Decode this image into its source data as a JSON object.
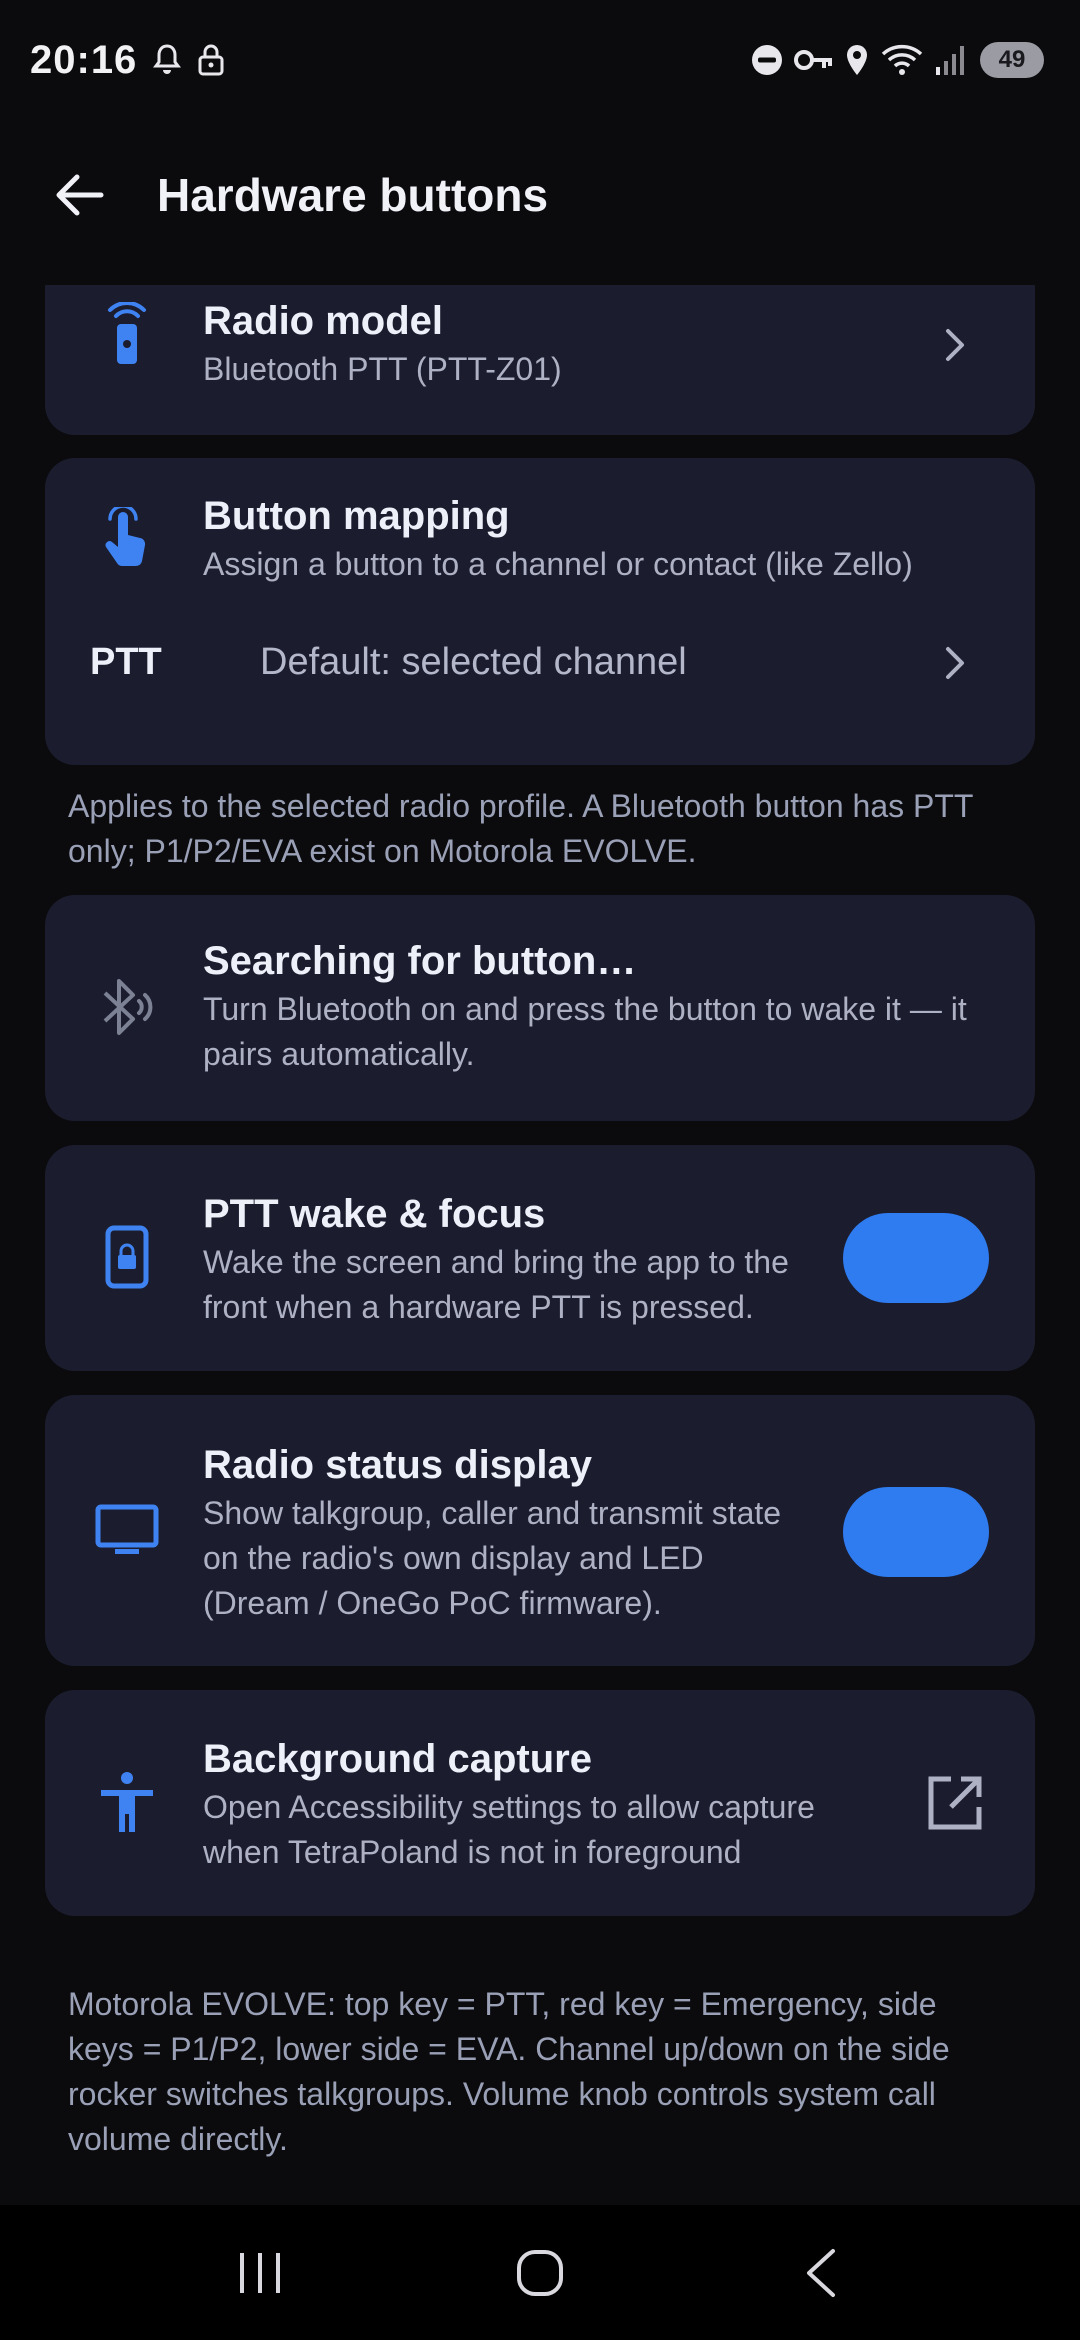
{
  "status_bar": {
    "time": "20:16",
    "battery": "49",
    "icons": [
      "alarm-icon",
      "lock-icon",
      "dnd-icon",
      "key-icon",
      "location-icon",
      "wifi-icon",
      "signal-icon"
    ]
  },
  "app_bar": {
    "title": "Hardware buttons"
  },
  "radio_model": {
    "title": "Radio model",
    "subtitle": "Bluetooth PTT (PTT-Z01)"
  },
  "button_mapping": {
    "title": "Button mapping",
    "subtitle": "Assign a button to a channel or contact (like Zello)",
    "ptt_label": "PTT",
    "ptt_value": "Default: selected channel"
  },
  "mapping_note": "Applies to the selected radio profile. A Bluetooth button has PTT only; P1/P2/EVA exist on Motorola EVOLVE.",
  "searching": {
    "title": "Searching for button…",
    "subtitle": "Turn Bluetooth on and press the button to wake it — it pairs automatically."
  },
  "ptt_wake": {
    "title": "PTT wake & focus",
    "subtitle": "Wake the screen and bring the app to the front when a hardware PTT is pressed.",
    "enabled": true
  },
  "radio_status": {
    "title": "Radio status display",
    "subtitle": "Show talkgroup, caller and transmit state on the radio's own display and LED (Dream / OneGo PoC firmware).",
    "enabled": true
  },
  "background_capture": {
    "title": "Background capture",
    "subtitle": "Open Accessibility settings to allow capture when TetraPoland is not in foreground"
  },
  "footer_note": "Motorola EVOLVE: top key = PTT, red key = Emergency, side keys = P1/P2, lower side = EVA. Channel up/down on the side rocker switches talkgroups. Volume knob controls system call volume directly.",
  "colors": {
    "accent": "#2f7bf0",
    "card": "#1b1d2f",
    "background": "#0b0b0e"
  }
}
